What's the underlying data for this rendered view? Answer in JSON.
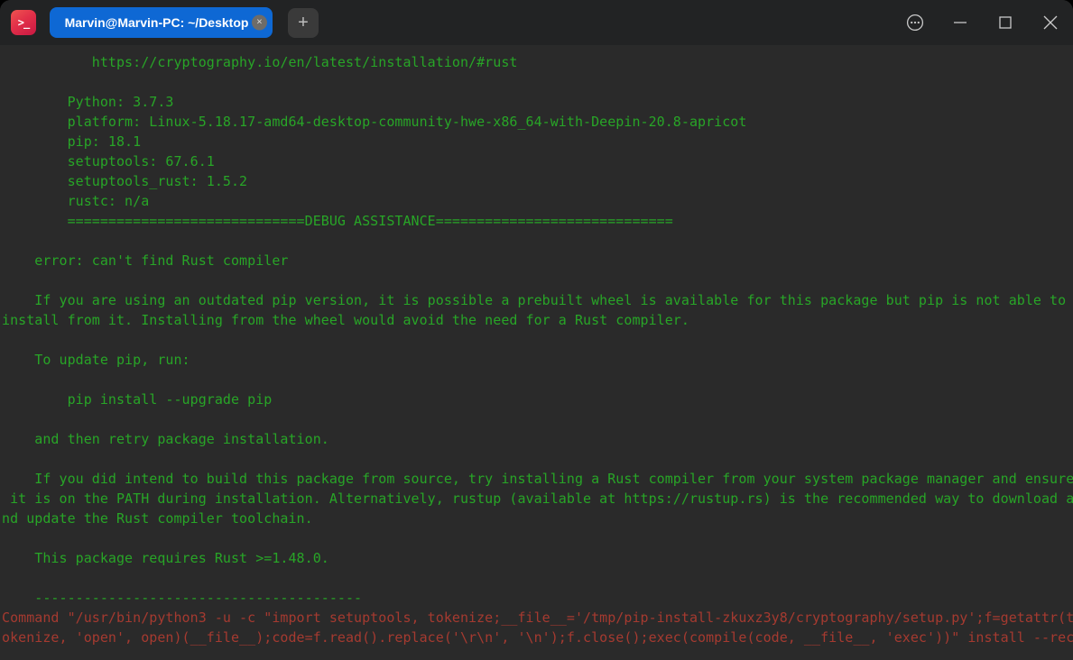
{
  "title_bar": {
    "app_icon_glyph": ">_",
    "tab": {
      "label": "Marvin@Marvin-PC: ~/Desktop",
      "close_glyph": "×"
    },
    "new_tab_glyph": "+",
    "controls": {
      "menu_icon": "circled-ellipsis",
      "minimize_icon": "minimize",
      "maximize_icon": "maximize",
      "close_icon": "close"
    },
    "colors": {
      "tab_active_background": "#0e68d4",
      "titlebar_background": "#222324",
      "app_icon_gradient_top": "#ef5450",
      "app_icon_gradient_bottom": "#c81843"
    }
  },
  "terminal": {
    "colors": {
      "background": "#2a2a2a",
      "green_text": "#28a527",
      "red_text": "#a53a30"
    },
    "lines": [
      {
        "c": "green",
        "t": "           https://cryptography.io/en/latest/installation/#rust"
      },
      {
        "c": "green",
        "t": ""
      },
      {
        "c": "green",
        "t": "        Python: 3.7.3"
      },
      {
        "c": "green",
        "t": "        platform: Linux-5.18.17-amd64-desktop-community-hwe-x86_64-with-Deepin-20.8-apricot"
      },
      {
        "c": "green",
        "t": "        pip: 18.1"
      },
      {
        "c": "green",
        "t": "        setuptools: 67.6.1"
      },
      {
        "c": "green",
        "t": "        setuptools_rust: 1.5.2"
      },
      {
        "c": "green",
        "t": "        rustc: n/a"
      },
      {
        "c": "green",
        "t": "        =============================DEBUG ASSISTANCE============================="
      },
      {
        "c": "green",
        "t": ""
      },
      {
        "c": "green",
        "t": "    error: can't find Rust compiler"
      },
      {
        "c": "green",
        "t": ""
      },
      {
        "c": "green",
        "t": "    If you are using an outdated pip version, it is possible a prebuilt wheel is available for this package but pip is not able to"
      },
      {
        "c": "green",
        "t": "install from it. Installing from the wheel would avoid the need for a Rust compiler."
      },
      {
        "c": "green",
        "t": ""
      },
      {
        "c": "green",
        "t": "    To update pip, run:"
      },
      {
        "c": "green",
        "t": ""
      },
      {
        "c": "green",
        "t": "        pip install --upgrade pip"
      },
      {
        "c": "green",
        "t": ""
      },
      {
        "c": "green",
        "t": "    and then retry package installation."
      },
      {
        "c": "green",
        "t": ""
      },
      {
        "c": "green",
        "t": "    If you did intend to build this package from source, try installing a Rust compiler from your system package manager and ensure"
      },
      {
        "c": "green",
        "t": " it is on the PATH during installation. Alternatively, rustup (available at https://rustup.rs) is the recommended way to download a"
      },
      {
        "c": "green",
        "t": "nd update the Rust compiler toolchain."
      },
      {
        "c": "green",
        "t": ""
      },
      {
        "c": "green",
        "t": "    This package requires Rust >=1.48.0."
      },
      {
        "c": "green",
        "t": ""
      },
      {
        "c": "green",
        "t": "    ----------------------------------------"
      },
      {
        "c": "red",
        "t": "Command \"/usr/bin/python3 -u -c \"import setuptools, tokenize;__file__='/tmp/pip-install-zkuxz3y8/cryptography/setup.py';f=getattr(t"
      },
      {
        "c": "red",
        "t": "okenize, 'open', open)(__file__);code=f.read().replace('\\r\\n', '\\n');f.close();exec(compile(code, __file__, 'exec'))\" install --rec"
      }
    ]
  }
}
